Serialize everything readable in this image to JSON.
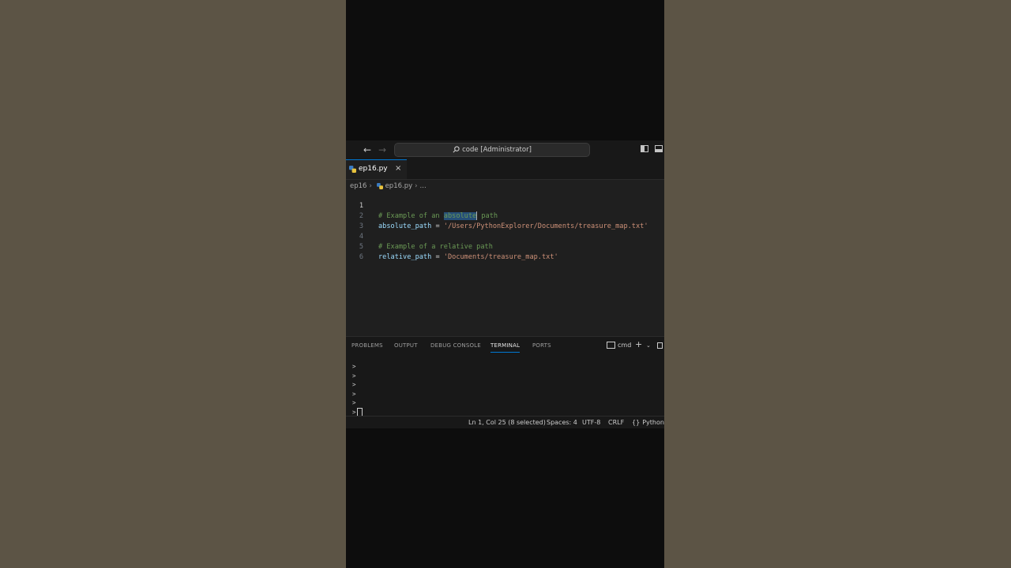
{
  "titlebar": {
    "search_text": "code [Administrator]"
  },
  "tab": {
    "label": "ep16.py",
    "close": "×"
  },
  "breadcrumb": {
    "folder": "ep16",
    "file": "ep16.py",
    "more": "..."
  },
  "code": {
    "line_numbers": [
      "1",
      "2",
      "3",
      "4",
      "5",
      "6"
    ],
    "line1_a": "# Example of an ",
    "line1_sel": "absolute",
    "line1_b": " path",
    "line2_var": "absolute_path",
    "line2_op": " = ",
    "line2_str": "'/Users/PythonExplorer/Documents/treasure_map.txt'",
    "line4": "# Example of a relative path",
    "line5_var": "relative_path",
    "line5_op": " = ",
    "line5_str": "'Documents/treasure_map.txt'"
  },
  "panel": {
    "tabs": [
      "PROBLEMS",
      "OUTPUT",
      "DEBUG CONSOLE",
      "TERMINAL",
      "PORTS"
    ],
    "active_tab": "TERMINAL",
    "terminal_name": "cmd",
    "prompt": ">"
  },
  "status": {
    "position": "Ln 1, Col 25 (8 selected)",
    "spaces": "Spaces: 4",
    "encoding": "UTF-8",
    "eol": "CRLF",
    "language": "Python"
  },
  "colors": {
    "accent": "#0078d4",
    "comment": "#6a9955",
    "variable": "#9cdcfe",
    "string": "#ce9178",
    "selection": "#264f78"
  }
}
